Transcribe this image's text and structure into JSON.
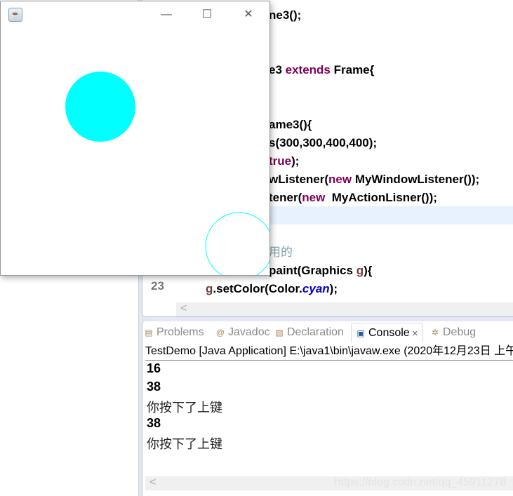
{
  "editor": {
    "line_number_visible": "23",
    "lines": [
      {
        "segments": [
          {
            "t": "ne3();",
            "c": ""
          }
        ]
      },
      {
        "segments": [
          {
            "t": "e3 ",
            "c": ""
          },
          {
            "t": "extends",
            "c": "kw"
          },
          {
            "t": " Frame{",
            "c": ""
          }
        ]
      },
      {
        "segments": [
          {
            "t": "ame3(){",
            "c": ""
          }
        ]
      },
      {
        "segments": [
          {
            "t": "s(300,300,400,400);",
            "c": ""
          }
        ]
      },
      {
        "segments": [
          {
            "t": "true",
            "c": "kw"
          },
          {
            "t": ");",
            "c": ""
          }
        ]
      },
      {
        "segments": [
          {
            "t": "wListener(",
            "c": ""
          },
          {
            "t": "new",
            "c": "kw"
          },
          {
            "t": " MyWindowListener());",
            "c": ""
          }
        ]
      },
      {
        "segments": [
          {
            "t": "tener(",
            "c": ""
          },
          {
            "t": "new",
            "c": "kw"
          },
          {
            "t": "  MyActionLisner());",
            "c": ""
          }
        ]
      },
      {
        "segments": [
          {
            "t": "用的",
            "c": "cm"
          }
        ]
      },
      {
        "segments": [
          {
            "t": "paint(Graphics ",
            "c": ""
          },
          {
            "t": "g",
            "c": "pm"
          },
          {
            "t": "){",
            "c": ""
          }
        ]
      },
      {
        "segments": [
          {
            "t": "g",
            "c": "pm"
          },
          {
            "t": ".setColor(Color.",
            "c": ""
          },
          {
            "t": "cyan",
            "c": "fd"
          },
          {
            "t": ");",
            "c": ""
          }
        ]
      }
    ]
  },
  "console": {
    "tabs": [
      {
        "label": "Problems",
        "icon": "problems-icon"
      },
      {
        "label": "Javadoc",
        "icon": "at-icon"
      },
      {
        "label": "Declaration",
        "icon": "declaration-icon"
      },
      {
        "label": "Console",
        "icon": "console-icon",
        "active": true
      },
      {
        "label": "Debug",
        "icon": "bug-icon"
      }
    ],
    "process": "TestDemo [Java Application] E:\\java1\\bin\\javaw.exe (2020年12月23日 上午",
    "output": [
      "16",
      "38",
      "你按下了上键",
      "38",
      "你按下了上键"
    ],
    "watermark": "https://blog.csdn.net/qq_45911278"
  },
  "frame": {
    "icon": "java-cup-icon",
    "circle_color": "#00ffff",
    "shapes": [
      {
        "type": "filled-oval",
        "color": "#00ffff"
      },
      {
        "type": "outline-oval",
        "color": "#00ffff"
      }
    ]
  }
}
